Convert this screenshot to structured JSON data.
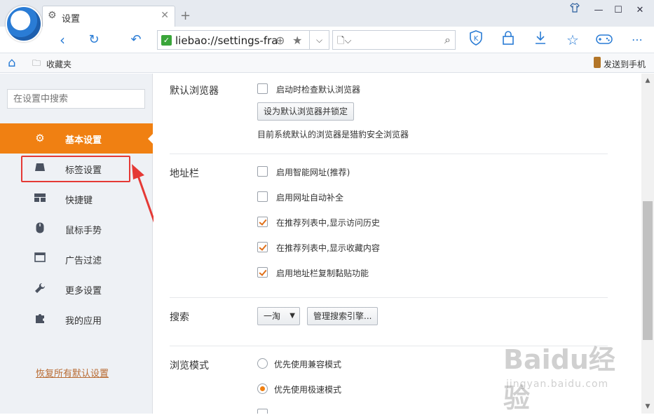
{
  "window": {
    "tab_title": "设置",
    "new_tab": "+",
    "controls": [
      "shirt-icon",
      "minimize-icon",
      "maximize-icon",
      "close-icon"
    ]
  },
  "toolbar": {
    "url": "liebao://settings-fra",
    "icons": [
      "back-icon",
      "refresh-icon",
      "undo-icon",
      "shield-k-icon",
      "lock-icon",
      "download-icon",
      "star-icon",
      "gamepad-icon",
      "more-icon"
    ]
  },
  "bookmarks": {
    "favorites": "收藏夹",
    "send_to_phone": "发送到手机"
  },
  "sidebar": {
    "search_placeholder": "在设置中搜索",
    "items": [
      {
        "label": "基本设置",
        "icon": "gear-icon",
        "active": true
      },
      {
        "label": "标签设置",
        "icon": "tab-icon",
        "active": false
      },
      {
        "label": "快捷键",
        "icon": "keyboard-icon",
        "active": false
      },
      {
        "label": "鼠标手势",
        "icon": "mouse-icon",
        "active": false
      },
      {
        "label": "广告过滤",
        "icon": "window-icon",
        "active": false
      },
      {
        "label": "更多设置",
        "icon": "wrench-icon",
        "active": false
      },
      {
        "label": "我的应用",
        "icon": "puzzle-icon",
        "active": false
      }
    ],
    "restore_defaults": "恢复所有默认设置"
  },
  "content": {
    "default_browser": {
      "label": "默认浏览器",
      "check_on_start": "启动时检查默认浏览器",
      "set_default_button": "设为默认浏览器并锁定",
      "note": "目前系统默认的浏览器是猎豹安全浏览器"
    },
    "address_bar": {
      "label": "地址栏",
      "options": [
        {
          "text": "启用智能网址(推荐)",
          "checked": false
        },
        {
          "text": "启用网址自动补全",
          "checked": false
        },
        {
          "text": "在推荐列表中,显示访问历史",
          "checked": true
        },
        {
          "text": "在推荐列表中,显示收藏内容",
          "checked": true
        },
        {
          "text": "启用地址栏复制黏贴功能",
          "checked": true
        }
      ]
    },
    "search": {
      "label": "搜索",
      "engine": "一淘",
      "manage_button": "管理搜索引擎..."
    },
    "browse_mode": {
      "label": "浏览模式",
      "options": [
        {
          "text": "优先使用兼容模式",
          "selected": false
        },
        {
          "text": "优先使用极速模式",
          "selected": true
        }
      ]
    }
  },
  "watermark": {
    "main": "Baidu经验",
    "sub": "jingyan.baidu.com"
  },
  "colors": {
    "accent": "#f08012",
    "brand_blue": "#2a7cd5",
    "highlight_red": "#e53935"
  }
}
